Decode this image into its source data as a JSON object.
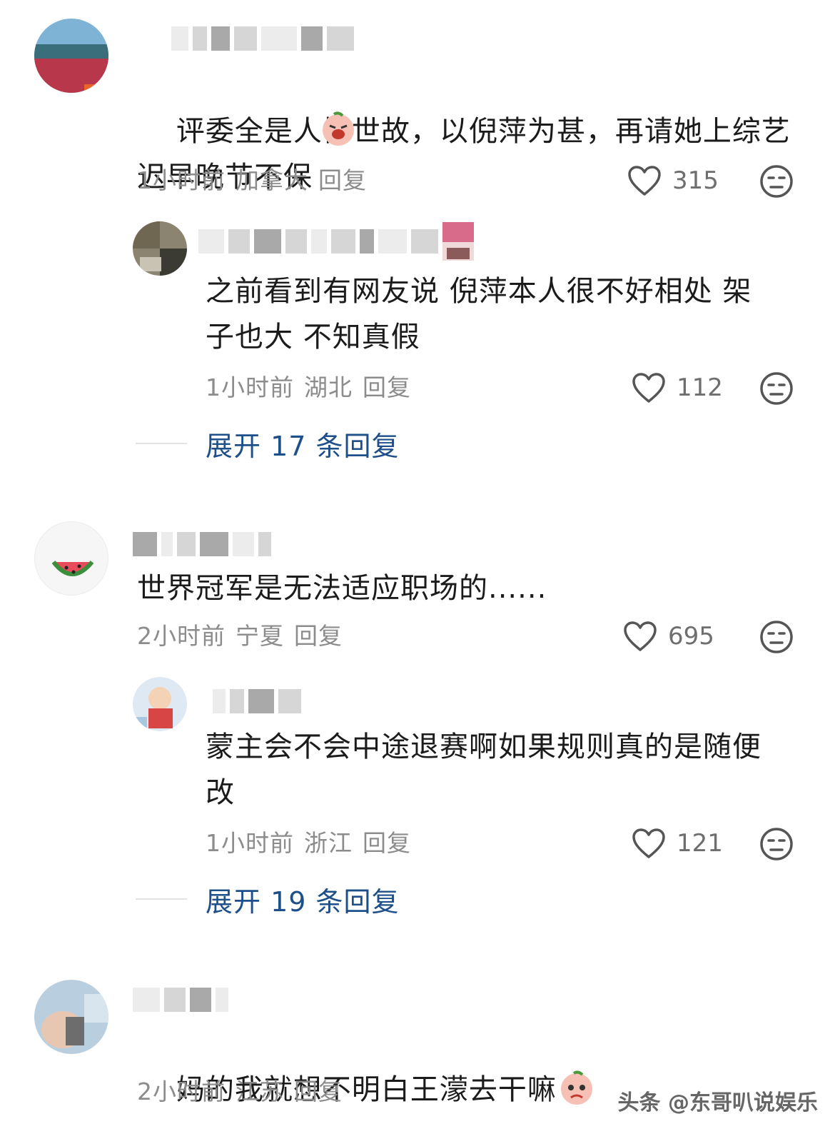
{
  "comments": [
    {
      "text": "评委全是人情世故，以倪萍为甚，再请她上综艺\n迟早晚节不保",
      "time": "1小时前",
      "location": "加拿大",
      "reply": "回复",
      "likes": "315",
      "replies": [
        {
          "text": "之前看到有网友说 倪萍本人很不好相处 架\n子也大 不知真假",
          "time": "1小时前",
          "location": "湖北",
          "reply": "回复",
          "likes": "112"
        }
      ],
      "expand": "展开 17 条回复"
    },
    {
      "text": "世界冠军是无法适应职场的......",
      "time": "2小时前",
      "location": "宁夏",
      "reply": "回复",
      "likes": "695",
      "replies": [
        {
          "text": "蒙主会不会中途退赛啊如果规则真的是随便\n改",
          "time": "1小时前",
          "location": "浙江",
          "reply": "回复",
          "likes": "121"
        }
      ],
      "expand": "展开 19 条回复"
    },
    {
      "text": "妈的我就想不明白王濛去干嘛",
      "time": "2小时前",
      "location": "江苏",
      "reply": "回复"
    }
  ],
  "watermark": "头条 @东哥叭说娱乐",
  "colors": {
    "link": "#1d4f8a",
    "meta": "#8c8c8c",
    "text": "#1b1b1b"
  },
  "icons": {
    "like": "heart-outline-icon",
    "react": "neutral-face-icon"
  }
}
